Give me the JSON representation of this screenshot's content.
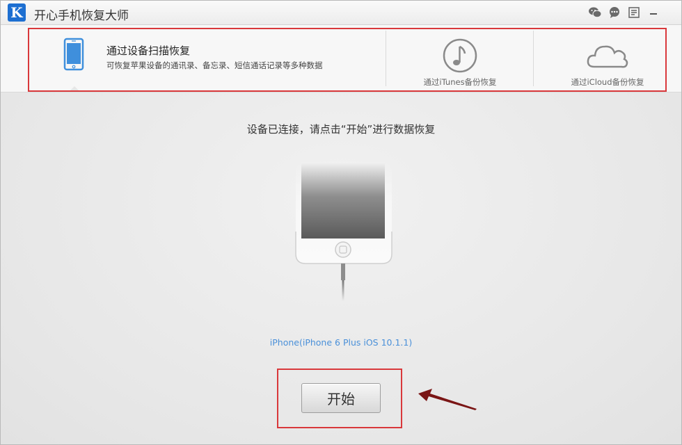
{
  "app": {
    "logo_letter": "K",
    "title": "开心手机恢复大师"
  },
  "titlebar": {
    "icons": [
      "wechat-icon",
      "chat-icon",
      "feedback-icon",
      "minimize-icon"
    ]
  },
  "modes": {
    "scan": {
      "title": "通过设备扫描恢复",
      "description": "可恢复苹果设备的通讯录、备忘录、短信通话记录等多种数据",
      "icon": "phone-icon"
    },
    "itunes": {
      "label": "通过iTunes备份恢复",
      "icon": "music-note-icon"
    },
    "icloud": {
      "label": "通过iCloud备份恢复",
      "icon": "cloud-icon"
    }
  },
  "main": {
    "instruction": "设备已连接，请点击“开始”进行数据恢复",
    "device_name": "iPhone(iPhone 6 Plus iOS 10.1.1)",
    "start_label": "开始"
  },
  "colors": {
    "annotation_red": "#d9383b",
    "device_link_blue": "#4a90d9",
    "arrow_dark_red": "#7a1515"
  }
}
